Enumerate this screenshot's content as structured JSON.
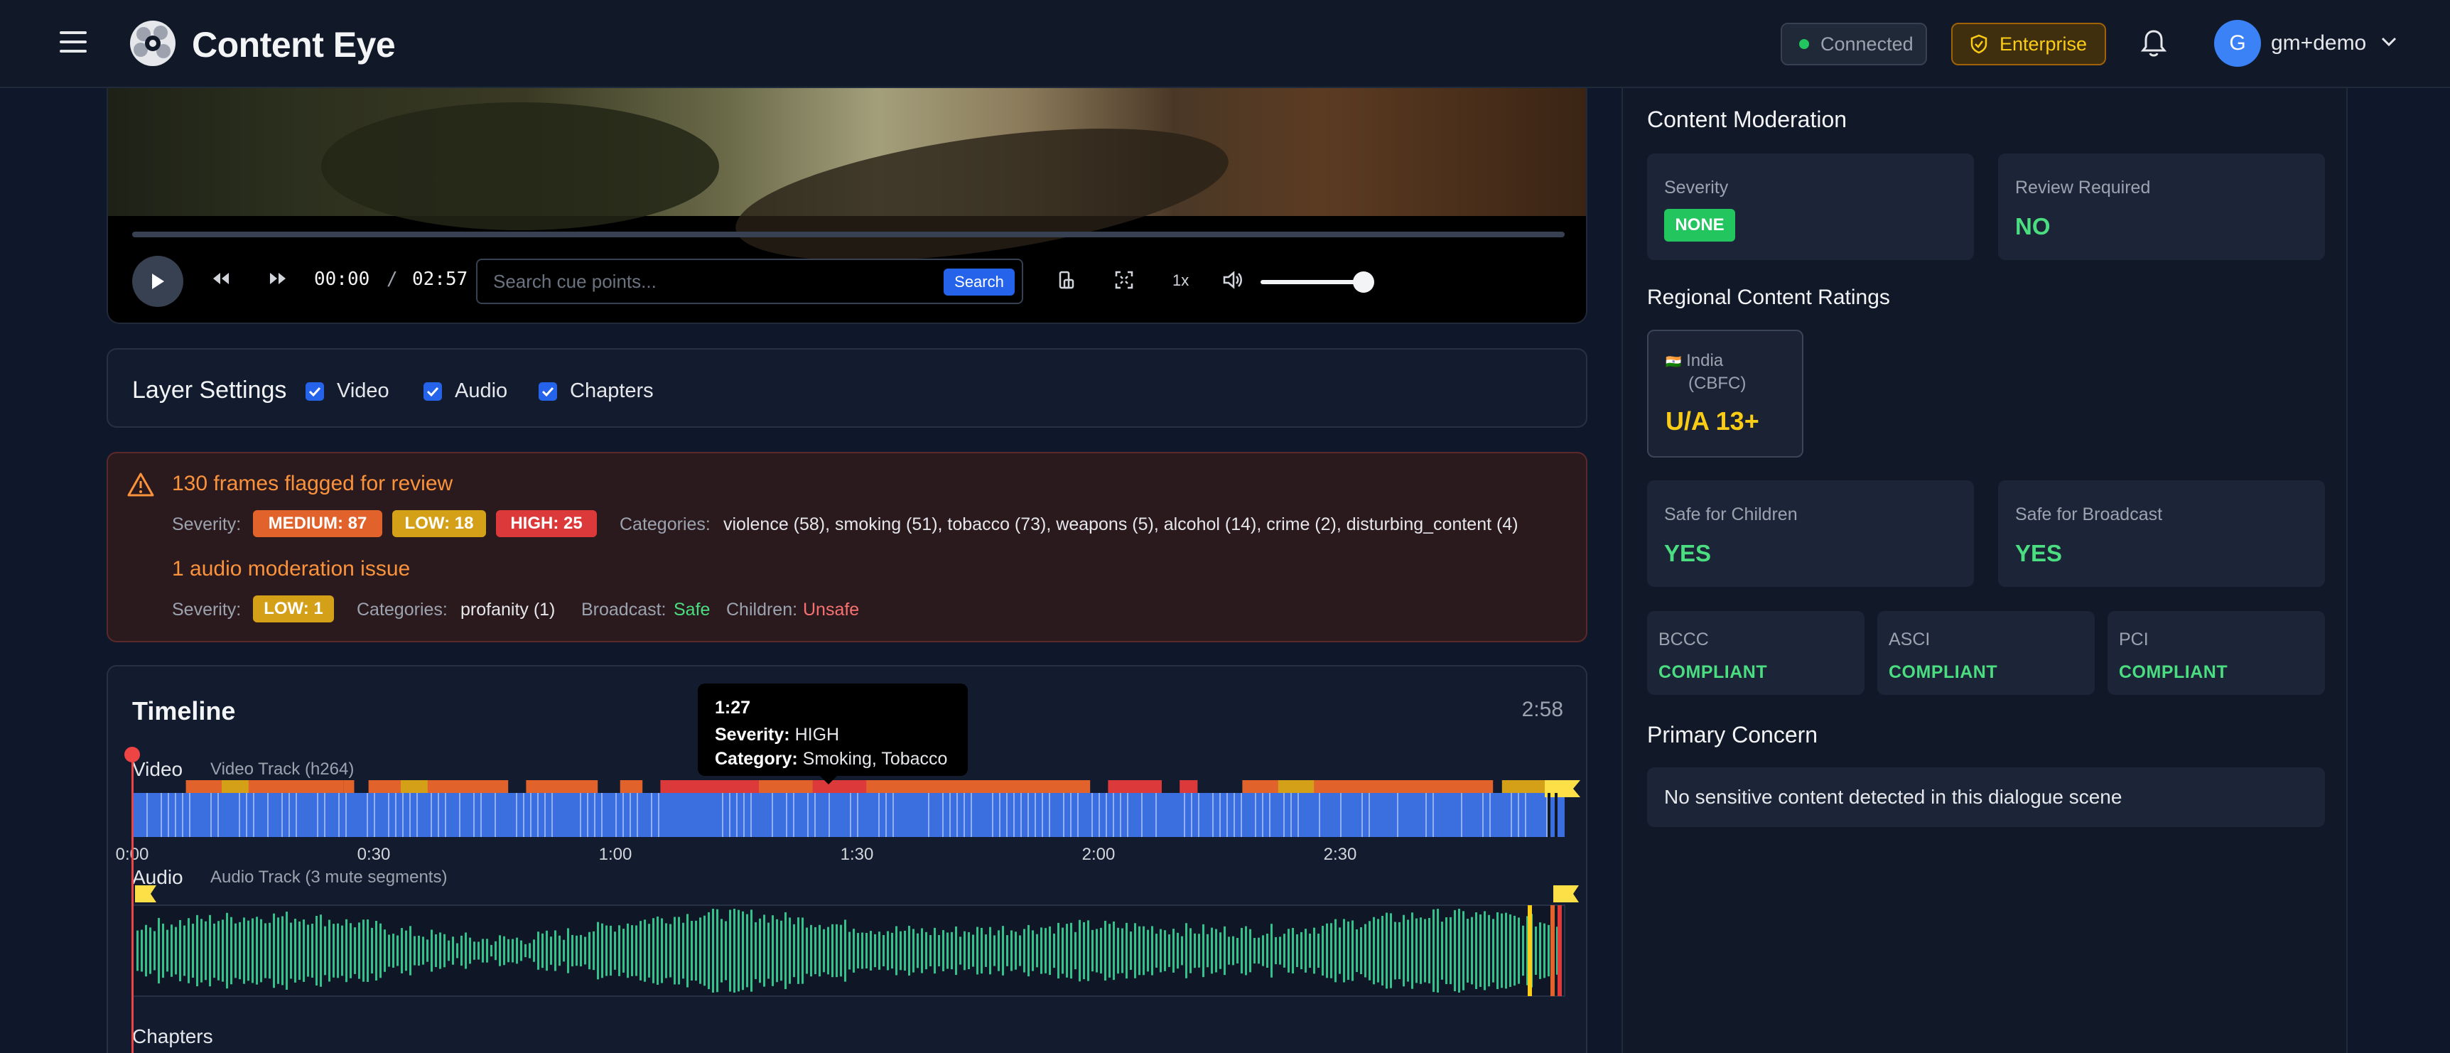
{
  "header": {
    "brand": "Content Eye",
    "connection_status": "Connected",
    "plan": "Enterprise",
    "user_initial": "G",
    "user_name": "gm+demo"
  },
  "player": {
    "current_time": "00:00",
    "separator": "/",
    "total_time": "02:57",
    "search_placeholder": "Search cue points...",
    "search_button": "Search",
    "speed": "1x",
    "volume_level": 0.9,
    "progress": 0
  },
  "layers": {
    "title": "Layer Settings",
    "items": [
      {
        "label": "Video",
        "checked": true
      },
      {
        "label": "Audio",
        "checked": true
      },
      {
        "label": "Chapters",
        "checked": true
      }
    ]
  },
  "alerts": {
    "frames_heading": "130 frames flagged for review",
    "severity_label": "Severity:",
    "frame_badges": [
      {
        "text": "MEDIUM: 87",
        "color": "#e2622b"
      },
      {
        "text": "LOW: 18",
        "color": "#d4a017"
      },
      {
        "text": "HIGH: 25",
        "color": "#dc3a3a"
      }
    ],
    "categories_label": "Categories:",
    "frame_categories": "violence (58), smoking (51), tobacco (73), weapons (5), alcohol (14), crime (2), disturbing_content (4)",
    "audio_heading": "1 audio moderation issue",
    "audio_badge": "LOW: 1",
    "audio_categories": "profanity (1)",
    "broadcast_label": "Broadcast:",
    "broadcast_value": "Safe",
    "children_label": "Children:",
    "children_value": "Unsafe"
  },
  "timeline": {
    "title": "Timeline",
    "duration": "2:58",
    "video_label": "Video",
    "video_track": "Video Track (h264)",
    "audio_label": "Audio",
    "audio_track": "Audio Track (3 mute segments)",
    "chapters_label": "Chapters",
    "ticks": [
      "0:00",
      "0:30",
      "1:00",
      "1:30",
      "2:00",
      "2:30"
    ],
    "tooltip": {
      "time": "1:27",
      "severity_label": "Severity:",
      "severity_value": "HIGH",
      "category_label": "Category:",
      "category_value": "Smoking, Tobacco"
    }
  },
  "moderation": {
    "title": "Content Moderation",
    "severity_label": "Severity",
    "severity_value": "NONE",
    "review_label": "Review Required",
    "review_value": "NO",
    "regional_title": "Regional Content Ratings",
    "region_flag": "🇮🇳",
    "region_name": "India",
    "region_body": "(CBFC)",
    "region_rating": "U/A 13+",
    "children_label": "Safe for Children",
    "children_value": "YES",
    "broadcast_label": "Safe for Broadcast",
    "broadcast_value": "YES",
    "compliance": [
      {
        "name": "BCCC",
        "status": "COMPLIANT"
      },
      {
        "name": "ASCI",
        "status": "COMPLIANT"
      },
      {
        "name": "PCI",
        "status": "COMPLIANT"
      }
    ],
    "concern_title": "Primary Concern",
    "concern_text": "No sensitive content detected in this dialogue scene"
  },
  "colors": {
    "accent": "#2563eb",
    "safe": "#4ade80",
    "warning": "#fb923c",
    "danger": "#ef4444",
    "rating": "#facc15"
  }
}
